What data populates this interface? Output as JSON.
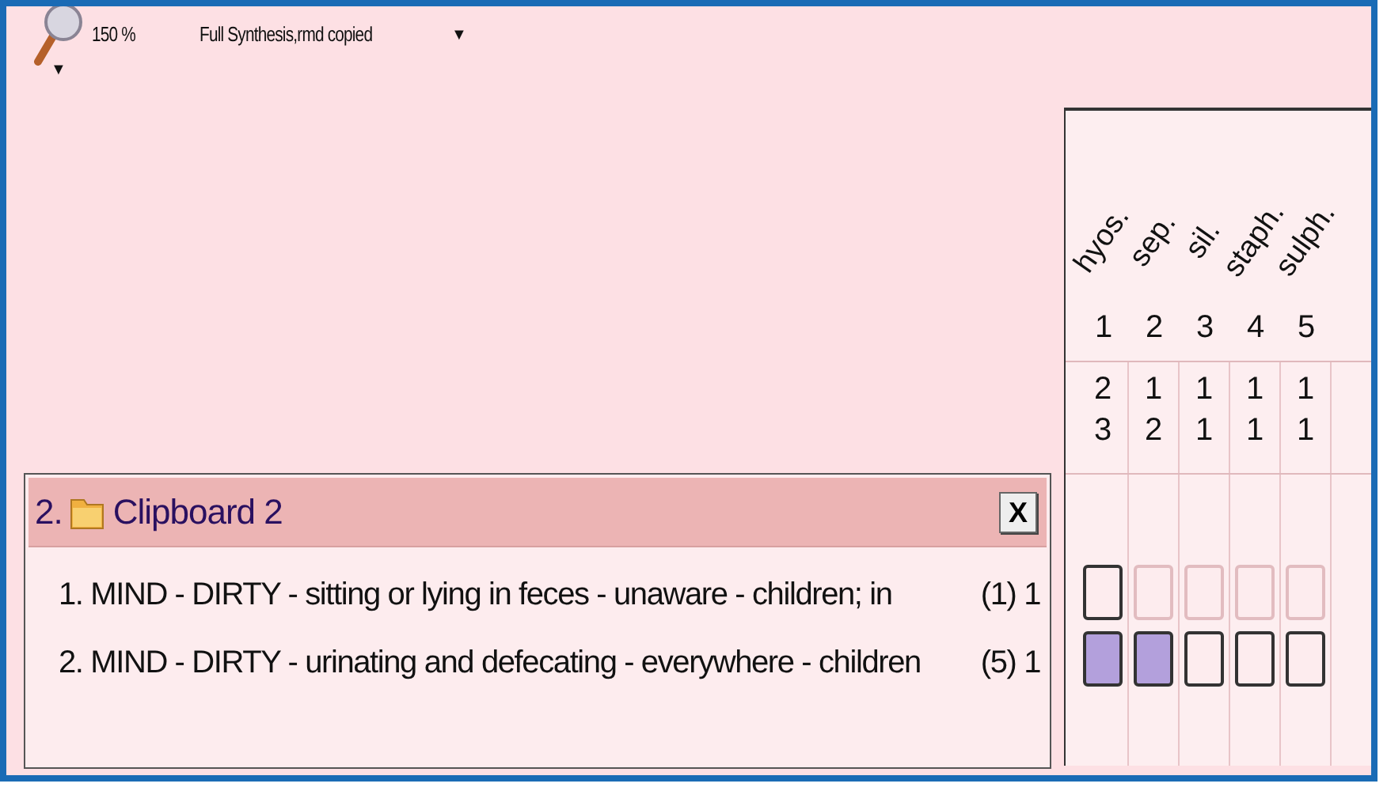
{
  "toolbar": {
    "zoom": "150 %",
    "zoom_menu": "▼",
    "status": "Full Synthesis,rmd copied",
    "status_menu": "▼"
  },
  "clipboard": {
    "number": "2.",
    "title": "Clipboard 2",
    "close": "X",
    "rubrics": [
      {
        "text": "1. MIND - DIRTY - sitting or lying in feces - unaware - children; in",
        "count": "(1) 1"
      },
      {
        "text": "2. MIND - DIRTY - urinating and defecating - everywhere - children",
        "count": "(5) 1"
      }
    ]
  },
  "remedies": [
    {
      "name": "hyos.",
      "number": "1",
      "counts": [
        "2",
        "3"
      ]
    },
    {
      "name": "sep.",
      "number": "2",
      "counts": [
        "1",
        "2"
      ]
    },
    {
      "name": "sil.",
      "number": "3",
      "counts": [
        "1",
        "1"
      ]
    },
    {
      "name": "staph.",
      "number": "4",
      "counts": [
        "1",
        "1"
      ]
    },
    {
      "name": "sulph.",
      "number": "5",
      "counts": [
        "1",
        "1"
      ]
    }
  ],
  "grid": [
    [
      {
        "kind": "outline"
      },
      {
        "kind": "faint"
      },
      {
        "kind": "faint"
      },
      {
        "kind": "faint"
      },
      {
        "kind": "faint"
      }
    ],
    [
      {
        "kind": "filled"
      },
      {
        "kind": "filled"
      },
      {
        "kind": "outline"
      },
      {
        "kind": "outline"
      },
      {
        "kind": "outline"
      }
    ]
  ]
}
